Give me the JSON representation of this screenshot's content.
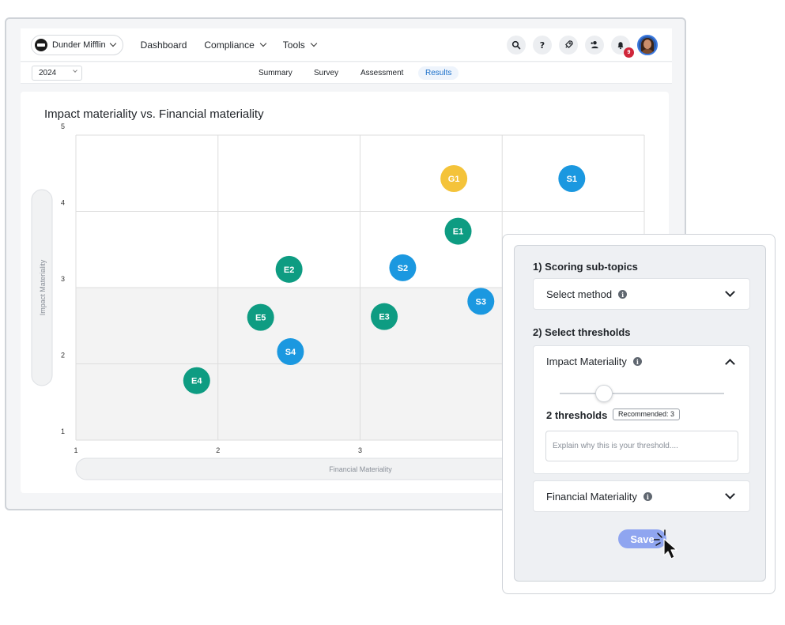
{
  "header": {
    "org_name": "Dunder Mifflin",
    "nav": [
      {
        "label": "Dashboard"
      },
      {
        "label": "Compliance"
      },
      {
        "label": "Tools"
      }
    ],
    "icons": [
      "search-icon",
      "help-icon",
      "rocket-icon",
      "add-user-icon",
      "bell-icon"
    ],
    "notification_count": "9"
  },
  "subnav": {
    "year": "2024",
    "tabs": [
      {
        "label": "Summary"
      },
      {
        "label": "Survey"
      },
      {
        "label": "Assessment"
      },
      {
        "label": "Results",
        "active": true
      }
    ]
  },
  "chart_data": {
    "type": "scatter",
    "title": "Impact materiality vs. Financial materiality",
    "xlabel": "Financial Materiality",
    "ylabel": "Impact Materiality",
    "xlim": [
      1,
      5
    ],
    "ylim": [
      1,
      5
    ],
    "xticks": [
      "1",
      "2",
      "3"
    ],
    "yticks": [
      "1",
      "2",
      "3",
      "4",
      "5"
    ],
    "grid": true,
    "shaded_region": {
      "x": [
        1,
        5
      ],
      "y": [
        1,
        3
      ]
    },
    "points": [
      {
        "label": "G1",
        "x": 3.66,
        "y": 4.43,
        "color": "#f4c33a"
      },
      {
        "label": "S1",
        "x": 4.49,
        "y": 4.43,
        "color": "#1b98e0"
      },
      {
        "label": "E1",
        "x": 3.69,
        "y": 3.74,
        "color": "#0e9c82"
      },
      {
        "label": "E2",
        "x": 2.5,
        "y": 3.24,
        "color": "#0e9c82"
      },
      {
        "label": "S2",
        "x": 3.3,
        "y": 3.26,
        "color": "#1b98e0"
      },
      {
        "label": "S3",
        "x": 3.85,
        "y": 2.82,
        "color": "#1b98e0"
      },
      {
        "label": "E5",
        "x": 2.3,
        "y": 2.61,
        "color": "#0e9c82"
      },
      {
        "label": "E3",
        "x": 3.17,
        "y": 2.62,
        "color": "#0e9c82"
      },
      {
        "label": "S4",
        "x": 2.51,
        "y": 2.16,
        "color": "#1b98e0"
      },
      {
        "label": "E4",
        "x": 1.85,
        "y": 1.78,
        "color": "#0e9c82"
      }
    ]
  },
  "panel": {
    "scoring_title": "1) Scoring sub-topics",
    "method_label": "Select method",
    "thresholds_title": "2) Select thresholds",
    "impact_label": "Impact Materiality",
    "slider_value": 0.27,
    "threshold_count": "2 thresholds",
    "recommended": "Recommended: 3",
    "explain_placeholder": "Explain why this is your threshold....",
    "financial_label": "Financial Materiality",
    "save_label": "Save"
  },
  "colors": {
    "green": "#0e9c82",
    "blue": "#1b98e0",
    "yellow": "#f4c33a",
    "accent": "#1b6fc9",
    "save_button": "#8fa5f0"
  }
}
